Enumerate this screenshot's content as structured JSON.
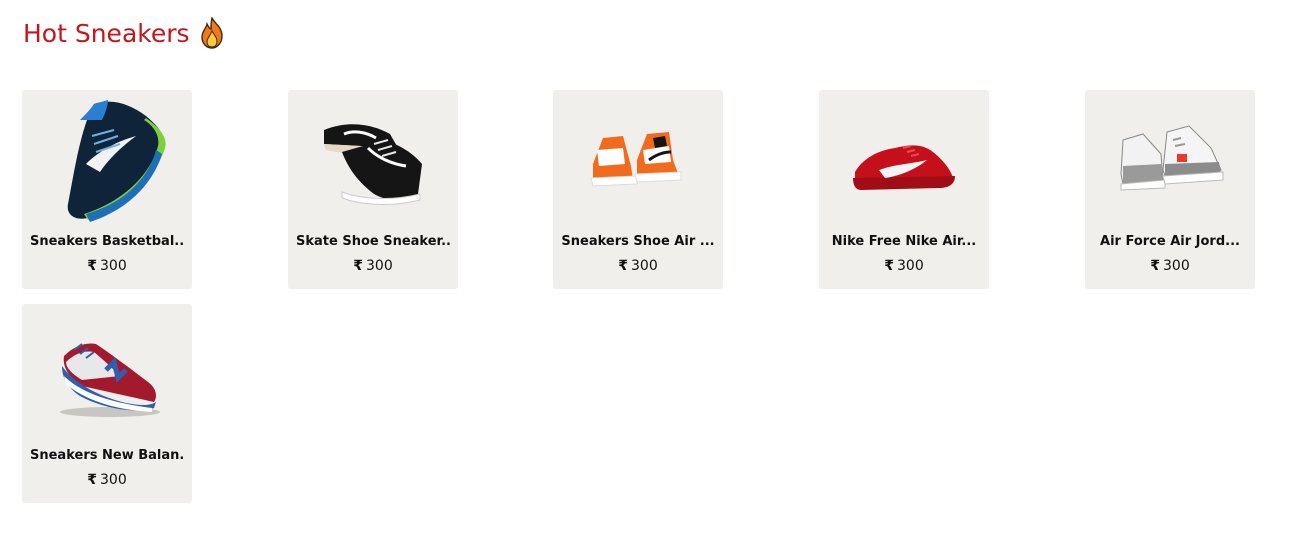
{
  "section": {
    "title": "Hot Sneakers",
    "title_icon": "fire-icon",
    "title_color": "#c4161c"
  },
  "card_background": "#f0efeb",
  "products": [
    {
      "name": "Sneakers Basketbal...",
      "currency": "₹",
      "price": "300",
      "image": "blue-green-running-shoe"
    },
    {
      "name": "Skate Shoe Sneaker...",
      "currency": "₹",
      "price": "300",
      "image": "black-white-skate-shoes"
    },
    {
      "name": "Sneakers Shoe Air ...",
      "currency": "₹",
      "price": "300",
      "image": "orange-high-top-sneakers"
    },
    {
      "name": "Nike Free Nike Air...",
      "currency": "₹",
      "price": "300",
      "image": "red-running-shoe"
    },
    {
      "name": "Air Force Air Jord...",
      "currency": "₹",
      "price": "300",
      "image": "white-grey-jordan-sneakers"
    },
    {
      "name": "Sneakers New Balan...",
      "currency": "₹",
      "price": "300",
      "image": "red-blue-new-balance-sneaker"
    }
  ]
}
